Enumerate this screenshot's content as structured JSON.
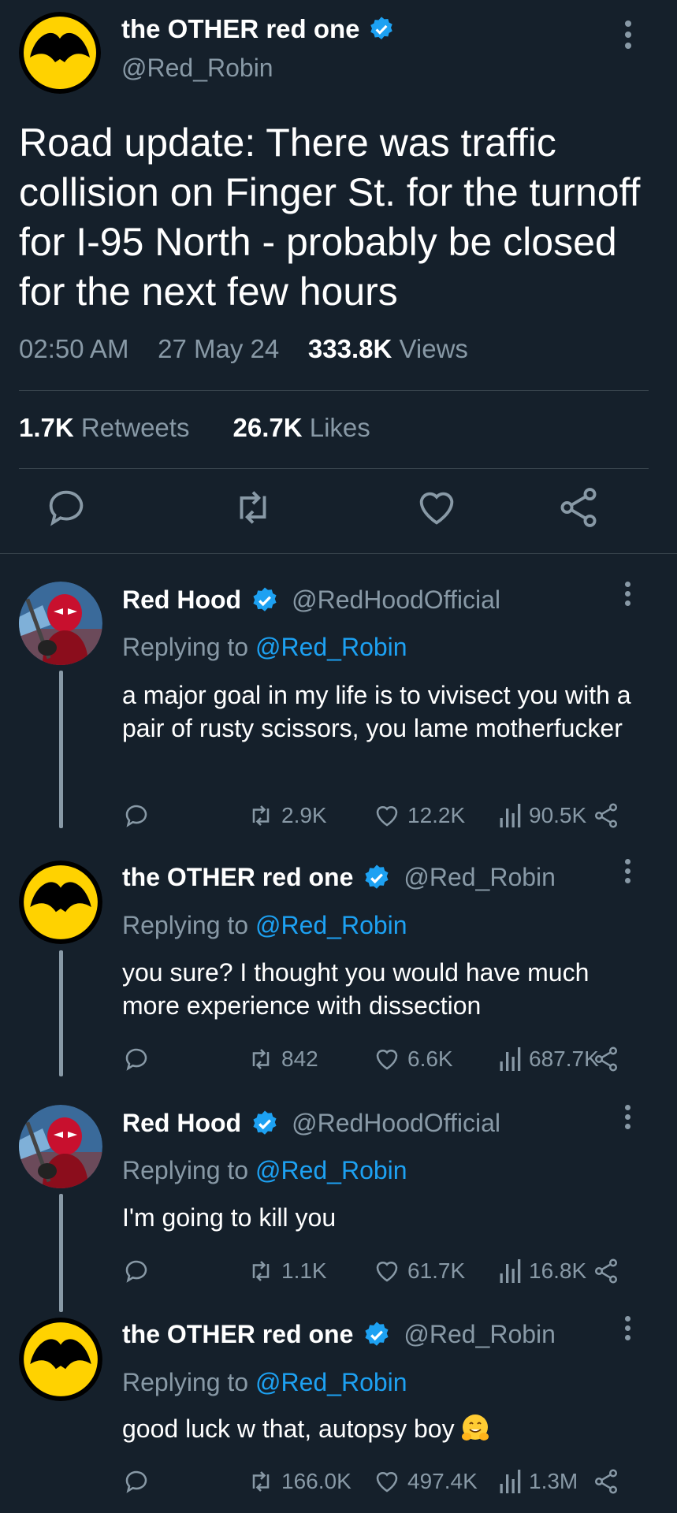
{
  "main_tweet": {
    "author": "the OTHER red one",
    "handle": "@Red_Robin",
    "text": "Road update: There was traffic collision on Finger St. for the turnoff for I-95 North - probably be closed for the next few hours",
    "time": "02:50 AM",
    "date": "27 May 24",
    "views_count": "333.8K",
    "views_label": "Views",
    "retweets_count": "1.7K",
    "retweets_label": "Retweets",
    "likes_count": "26.7K",
    "likes_label": "Likes"
  },
  "replies": [
    {
      "author": "Red Hood",
      "handle": "@RedHoodOfficial",
      "replying_prefix": "Replying to",
      "replying_to": "@Red_Robin",
      "text": "a major goal in my life is to vivisect you with a pair of rusty scissors, you  lame motherfucker",
      "retweets": "2.9K",
      "likes": "12.2K",
      "views": "90.5K"
    },
    {
      "author": "the OTHER red one",
      "handle": "@Red_Robin",
      "replying_prefix": "Replying to",
      "replying_to": "@Red_Robin",
      "text": "you sure? I thought you would have much more experience with dissection",
      "retweets": "842",
      "likes": "6.6K",
      "views": "687.7K"
    },
    {
      "author": "Red Hood",
      "handle": "@RedHoodOfficial",
      "replying_prefix": "Replying to",
      "replying_to": "@Red_Robin",
      "text": "I'm going to kill you",
      "retweets": "1.1K",
      "likes": "61.7K",
      "views": "16.8K"
    },
    {
      "author": "the OTHER red one",
      "handle": "@Red_Robin",
      "replying_prefix": "Replying to",
      "replying_to": "@Red_Robin",
      "text": "good luck w that, autopsy boy",
      "retweets": "166.0K",
      "likes": "497.4K",
      "views": "1.3M"
    }
  ],
  "colors": {
    "background": "#15202b",
    "secondary_text": "#8899a6",
    "link": "#1da1f2",
    "verified": "#1da1f2",
    "divider": "#38444d",
    "robin_yellow": "#ffd200"
  },
  "icons": [
    "reply-icon",
    "retweet-icon",
    "like-icon",
    "share-icon",
    "views-icon",
    "verified-icon",
    "more-icon",
    "hugging-face-emoji"
  ]
}
